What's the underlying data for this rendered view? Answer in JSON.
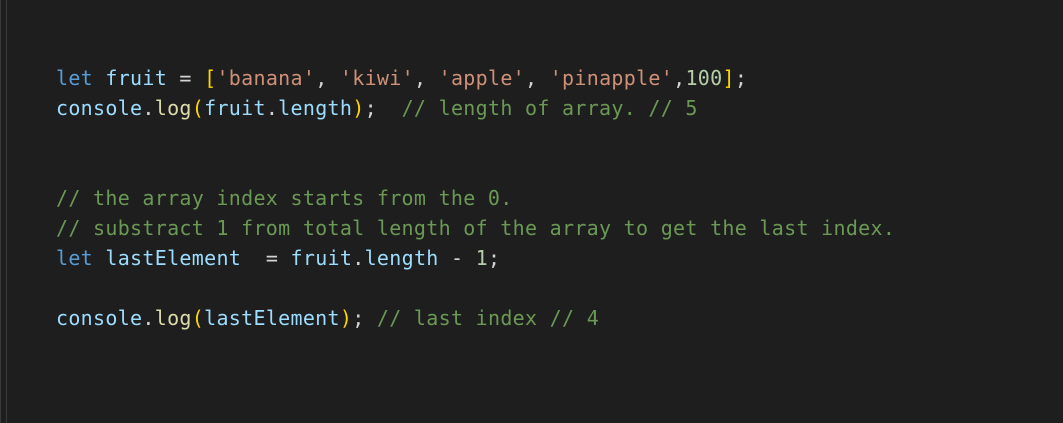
{
  "editor": {
    "lines": [
      {
        "tokens": [
          {
            "t": "let",
            "c": "kw"
          },
          {
            "t": " ",
            "c": "punc"
          },
          {
            "t": "fruit",
            "c": "var"
          },
          {
            "t": " = ",
            "c": "punc"
          },
          {
            "t": "[",
            "c": "b1"
          },
          {
            "t": "'banana'",
            "c": "str"
          },
          {
            "t": ", ",
            "c": "punc"
          },
          {
            "t": "'kiwi'",
            "c": "str"
          },
          {
            "t": ", ",
            "c": "punc"
          },
          {
            "t": "'apple'",
            "c": "str"
          },
          {
            "t": ", ",
            "c": "punc"
          },
          {
            "t": "'pinapple'",
            "c": "str"
          },
          {
            "t": ",",
            "c": "punc"
          },
          {
            "t": "100",
            "c": "num"
          },
          {
            "t": "]",
            "c": "b1"
          },
          {
            "t": ";",
            "c": "punc"
          }
        ]
      },
      {
        "tokens": [
          {
            "t": "console",
            "c": "var"
          },
          {
            "t": ".",
            "c": "punc"
          },
          {
            "t": "log",
            "c": "fn"
          },
          {
            "t": "(",
            "c": "b1"
          },
          {
            "t": "fruit",
            "c": "var"
          },
          {
            "t": ".",
            "c": "punc"
          },
          {
            "t": "length",
            "c": "var"
          },
          {
            "t": ")",
            "c": "b1"
          },
          {
            "t": ";  ",
            "c": "punc"
          },
          {
            "t": "// length of array. // 5",
            "c": "cmt"
          }
        ]
      },
      {
        "tokens": []
      },
      {
        "tokens": []
      },
      {
        "tokens": [
          {
            "t": "// the array index starts from the 0.",
            "c": "cmt"
          }
        ]
      },
      {
        "tokens": [
          {
            "t": "// substract 1 from total length of the array to get the last index.",
            "c": "cmt"
          }
        ]
      },
      {
        "tokens": [
          {
            "t": "let",
            "c": "kw"
          },
          {
            "t": " ",
            "c": "punc"
          },
          {
            "t": "lastElement",
            "c": "var"
          },
          {
            "t": "  = ",
            "c": "punc"
          },
          {
            "t": "fruit",
            "c": "var"
          },
          {
            "t": ".",
            "c": "punc"
          },
          {
            "t": "length",
            "c": "var"
          },
          {
            "t": " - ",
            "c": "punc"
          },
          {
            "t": "1",
            "c": "num"
          },
          {
            "t": ";",
            "c": "punc"
          }
        ]
      },
      {
        "tokens": []
      },
      {
        "tokens": [
          {
            "t": "console",
            "c": "var"
          },
          {
            "t": ".",
            "c": "punc"
          },
          {
            "t": "log",
            "c": "fn"
          },
          {
            "t": "(",
            "c": "b1"
          },
          {
            "t": "lastElement",
            "c": "var"
          },
          {
            "t": ")",
            "c": "b1"
          },
          {
            "t": "; ",
            "c": "punc"
          },
          {
            "t": "// last index // 4",
            "c": "cmt"
          }
        ]
      }
    ]
  },
  "theme": {
    "background": "#1e1e1e",
    "keyword": "#569cd6",
    "variable": "#9cdcfe",
    "function": "#dcdcaa",
    "string": "#ce9178",
    "number": "#b5cea8",
    "comment": "#6a9955",
    "bracket": "#ffd700"
  }
}
